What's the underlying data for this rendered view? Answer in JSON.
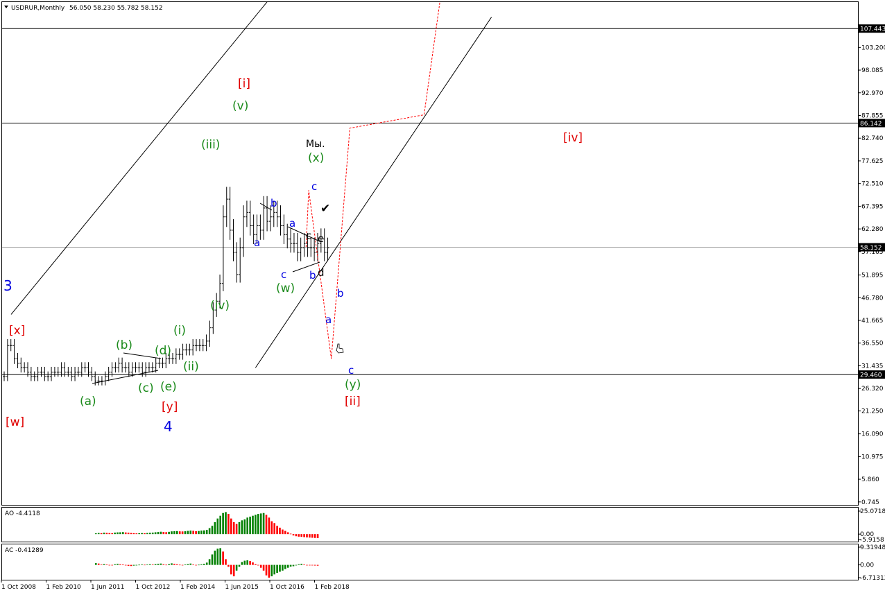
{
  "header": {
    "symbol": "USDRUR,Monthly",
    "ohlc": "56.050 58.230 55.782 58.152"
  },
  "colors": {
    "grid_frame": "#000000",
    "bar": "#000000",
    "ao_up": "#008000",
    "ao_down": "#ff0000",
    "forecast": "#ff0000",
    "wave_green": "#1a8a1a",
    "wave_red": "#e00000",
    "wave_blue": "#0000e0",
    "wave_black": "#000000",
    "price_box": "#000000",
    "level_line": "#a0a0a0"
  },
  "chart_data": [
    {
      "type": "ohlc",
      "symbol": "USDRUR",
      "timeframe": "Monthly",
      "ylim": [
        0.745,
        110.5
      ],
      "y_ticks": [
        "0.745",
        "5.860",
        "10.975",
        "16.090",
        "21.250",
        "26.320",
        "31.435",
        "36.550",
        "41.665",
        "46.780",
        "51.895",
        "57.165",
        "62.280",
        "67.395",
        "72.510",
        "77.625",
        "82.740",
        "87.855",
        "92.970",
        "98.085",
        "103.200"
      ],
      "x_ticks": [
        "1 Oct 2008",
        "1 Feb 2010",
        "1 Jun 2011",
        "1 Oct 2012",
        "1 Feb 2014",
        "1 Jun 2015",
        "1 Oct 2016",
        "1 Feb 2018"
      ],
      "levels": [
        {
          "value": 107.443,
          "label": "107.443"
        },
        {
          "value": 86.142,
          "label": "86.142"
        },
        {
          "value": 29.46,
          "label": "29.460"
        }
      ],
      "current_price": {
        "value": 58.152,
        "label": "58.152"
      },
      "closes": [
        29,
        36,
        36,
        33,
        32,
        31,
        31,
        30,
        29,
        29,
        30,
        30,
        29,
        29,
        30,
        30,
        30,
        31,
        30,
        30,
        29,
        30,
        30,
        31,
        31,
        30,
        29,
        28,
        28,
        28,
        29,
        30,
        31,
        31,
        32,
        31,
        31,
        30,
        31,
        31,
        31,
        30,
        31,
        31,
        31,
        32,
        32,
        32,
        33,
        33,
        33,
        34,
        34,
        35,
        35,
        35,
        36,
        36,
        36,
        36,
        37,
        40,
        44,
        46,
        50,
        65,
        69,
        62,
        57,
        52,
        58,
        65,
        66,
        63,
        61,
        63,
        62,
        67,
        64,
        65,
        66,
        65,
        63,
        61,
        60,
        59,
        59,
        57,
        58,
        59,
        58,
        58,
        57,
        59,
        60,
        57,
        58
      ],
      "forecast_path": [
        [
          2017.5,
          58.2
        ],
        [
          2017.58,
          71
        ],
        [
          2018.25,
          33
        ],
        [
          2018.8,
          85
        ],
        [
          2021.0,
          88
        ],
        [
          2021.5,
          115
        ]
      ],
      "channel_lines": [
        {
          "from": [
            2008.75,
            43
          ],
          "to": [
            2017.05,
            120
          ]
        },
        {
          "from": [
            2016.0,
            31
          ],
          "to": [
            2023.0,
            110
          ]
        }
      ]
    },
    {
      "type": "bar",
      "name": "AO",
      "title": "AO -4.4118",
      "y_ticks": [
        "25.0718",
        "0.00",
        "-5.9158"
      ],
      "ylim": [
        -5.9158,
        25.0718
      ],
      "values": [
        0.8,
        1.2,
        1.0,
        1.5,
        1.3,
        1.1,
        1.0,
        1.6,
        1.9,
        2.0,
        2.2,
        1.8,
        1.5,
        1.2,
        1.0,
        0.8,
        0.9,
        1.1,
        0.9,
        1.2,
        1.4,
        1.6,
        2.0,
        2.3,
        2.6,
        2.4,
        2.1,
        2.5,
        3.0,
        3.2,
        3.3,
        3.0,
        2.9,
        3.1,
        3.5,
        3.8,
        3.6,
        3.2,
        3.4,
        3.8,
        4.0,
        4.6,
        6.5,
        9,
        13,
        17,
        20,
        23,
        24,
        22,
        17,
        13,
        11,
        13,
        15,
        16,
        18,
        19,
        20,
        21,
        22,
        22.5,
        23,
        21,
        18,
        14,
        12,
        9,
        7,
        5,
        3.5,
        2,
        0.5,
        -1.5,
        -2.3,
        -2.8,
        -3.0,
        -3.3,
        -3.6,
        -3.8,
        -4.0,
        -4.2,
        -4.4118
      ],
      "colors": [
        "up",
        "up",
        "down",
        "up",
        "down",
        "down",
        "down",
        "up",
        "up",
        "up",
        "up",
        "down",
        "down",
        "down",
        "down",
        "down",
        "up",
        "up",
        "down",
        "up",
        "up",
        "up",
        "up",
        "up",
        "up",
        "down",
        "down",
        "up",
        "up",
        "up",
        "up",
        "down",
        "down",
        "up",
        "up",
        "up",
        "down",
        "down",
        "up",
        "up",
        "up",
        "up",
        "up",
        "up",
        "up",
        "up",
        "up",
        "up",
        "up",
        "down",
        "down",
        "down",
        "down",
        "up",
        "up",
        "up",
        "up",
        "up",
        "up",
        "up",
        "up",
        "up",
        "up",
        "down",
        "down",
        "down",
        "down",
        "down",
        "down",
        "down",
        "down",
        "down",
        "down",
        "down",
        "down",
        "down",
        "down",
        "down",
        "down",
        "down",
        "down",
        "down",
        "down"
      ]
    },
    {
      "type": "bar",
      "name": "AC",
      "title": "AC -0.41289",
      "y_ticks": [
        "9.31948",
        "0.00",
        "-6.71312"
      ],
      "ylim": [
        -6.71312,
        9.31948
      ],
      "values": [
        0.9,
        0.7,
        0.3,
        0.5,
        0.2,
        -0.1,
        -0.2,
        0.4,
        0.6,
        0.4,
        0.2,
        -0.3,
        -0.5,
        -0.6,
        -0.4,
        -0.3,
        0.1,
        0.3,
        0.1,
        0.2,
        0.4,
        0.3,
        0.5,
        0.6,
        0.7,
        0.4,
        0.1,
        0.5,
        0.8,
        0.6,
        0.4,
        0.1,
        -0.1,
        0.2,
        0.5,
        0.7,
        0.3,
        -0.2,
        0.1,
        0.4,
        0.6,
        1.2,
        3,
        5.5,
        7.5,
        8.5,
        8.8,
        7,
        3,
        -1,
        -5,
        -6,
        -3,
        -1,
        1.5,
        2.2,
        2.4,
        2.0,
        1.3,
        0.5,
        -0.3,
        -1.5,
        -3,
        -5.5,
        -6.7,
        -6,
        -5,
        -4.2,
        -3.6,
        -3,
        -2.2,
        -1.5,
        -0.9,
        -0.7,
        -0.3,
        0.4,
        0.6,
        0.3,
        0.0,
        -0.2,
        -0.3,
        -0.35,
        -0.41289
      ],
      "colors": [
        "up",
        "down",
        "down",
        "up",
        "down",
        "down",
        "down",
        "up",
        "up",
        "down",
        "down",
        "down",
        "down",
        "down",
        "up",
        "up",
        "up",
        "up",
        "down",
        "up",
        "up",
        "down",
        "up",
        "up",
        "up",
        "down",
        "down",
        "up",
        "up",
        "down",
        "down",
        "down",
        "down",
        "up",
        "up",
        "up",
        "down",
        "down",
        "up",
        "up",
        "up",
        "up",
        "up",
        "up",
        "up",
        "up",
        "up",
        "down",
        "down",
        "down",
        "down",
        "down",
        "up",
        "up",
        "up",
        "up",
        "up",
        "down",
        "down",
        "down",
        "down",
        "down",
        "down",
        "down",
        "down",
        "up",
        "up",
        "up",
        "up",
        "up",
        "up",
        "up",
        "up",
        "up",
        "up",
        "up",
        "up",
        "down",
        "down",
        "down",
        "down",
        "down",
        "down"
      ]
    }
  ],
  "wave_labels": {
    "x_red": "[x]",
    "w_red": "[w]",
    "three_blue": "3",
    "four_blue": "4",
    "y_red": "[y]",
    "a_green": "(a)",
    "b_green": "(b)",
    "c_green": "(c)",
    "d_green": "(d)",
    "e_green": "(e)",
    "i_green": "(i)",
    "ii_green": "(ii)",
    "iii_green": "(iii)",
    "iv_green": "(iv)",
    "v_green": "(v)",
    "i_red": "[i]",
    "my_black": "Мы.",
    "x_green": "(x)",
    "c_blue_top": "c",
    "b_blue_1": "b",
    "a_blue_1": "a",
    "a_blue_2": "a",
    "c_black": "c",
    "e_black": "e",
    "c_blue_2": "c",
    "w_green": "(w)",
    "b_blue_2": "b",
    "d_black": "d",
    "b_blue_f": "b",
    "a_blue_f": "a",
    "c_blue_f": "c",
    "y_green": "(y)",
    "ii_red": "[ii]",
    "iv_red": "[iv]",
    "check": "✔"
  }
}
